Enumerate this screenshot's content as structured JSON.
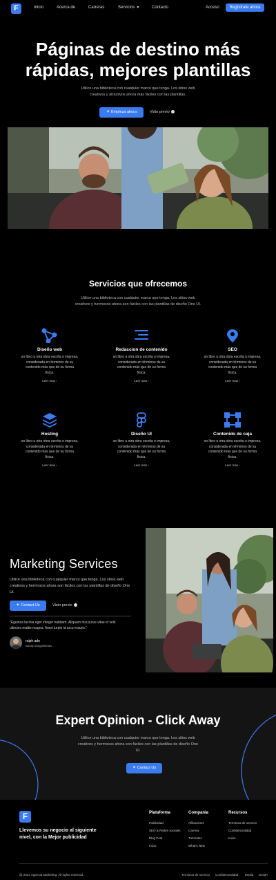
{
  "nav": {
    "logo_letter": "F",
    "links": [
      "Inicio",
      "Acerca de",
      "Carreras",
      "Servicios",
      "Contacto"
    ],
    "login": "Acceso",
    "register": "Regístrate ahora"
  },
  "hero": {
    "title_line1": "Páginas de destino más",
    "title_line2": "rápidas, mejores plantillas",
    "subtitle": "Utilice una biblioteca con cualquier marco que tenga. Los sitios web creativos y atractivos ahora más fáciles con las plantillas.",
    "cta": "Empieza ahora",
    "preview": "Visto previo"
  },
  "services": {
    "title": "Servicios que ofrecemos",
    "subtitle": "Utilice una biblioteca con cualquier marco que tenga. Los sitios web creativos y hermosos ahora son fáciles con las plantillas de diseño One UI.",
    "description": "un libro u otra obra escrita o impresa, considerada en términos de su contenido más que de su forma física.",
    "more": "Leer mas",
    "items": [
      {
        "title": "Diseño web",
        "icon": "share-nodes-icon"
      },
      {
        "title": "Redaccion de contenido",
        "icon": "text-align-icon"
      },
      {
        "title": "SEO",
        "icon": "location-pin-icon"
      },
      {
        "title": "Hosting",
        "icon": "layers-icon"
      },
      {
        "title": "Diseño UI",
        "icon": "figma-icon"
      },
      {
        "title": "Contenido de caja",
        "icon": "vector-box-icon"
      }
    ]
  },
  "marketing": {
    "title": "Marketing Services",
    "subtitle": "Utilice una biblioteca con cualquier marco que tenga. Los sitios web creativos y hermosos ahora son fáciles con las plantillas de diseño One Ui.",
    "cta": "Contact Us",
    "preview": "Visto previo",
    "quote": "\"Egestas lacinia eget integer habitant. Aliquam nisi purus vitae id velit ultricies mattis magna. Amet turpis id arcu mauris.\"",
    "author_name": "ralph ado",
    "author_role": "Sacep inegorbenta"
  },
  "expert": {
    "title": "Expert Opinion - Click Away",
    "subtitle": "Utilice una biblioteca con cualquier marco que tenga. Los sitios web creativos y hermosos ahora son fáciles con las plantillas de diseño One Ui.",
    "cta": "Contact Us"
  },
  "footer": {
    "logo_letter": "F",
    "tagline": "Llevemos su negocio al siguiente nivel, con la Mejor publicidad",
    "columns": [
      {
        "heading": "Plataforma",
        "items": [
          "Publicidad",
          "SEO & Redes sociales",
          "Blog Post",
          "Inicio"
        ]
      },
      {
        "heading": "Compania",
        "items": [
          "Afiliaciones",
          "Carrera",
          "Tutoriales",
          "What's New"
        ]
      },
      {
        "heading": "Recursos",
        "items": [
          "Terminos de servicio",
          "Confidencialidad",
          "Inicio"
        ]
      }
    ],
    "copyright": "@ 2024 Agencia Marketing. All rights reserved.",
    "legal": [
      "Terminos de servicio",
      "Confidencialidad",
      "Media",
      "DCMA"
    ]
  },
  "colors": {
    "accent": "#3a7cf0",
    "background": "#000000",
    "panel": "#141414"
  }
}
